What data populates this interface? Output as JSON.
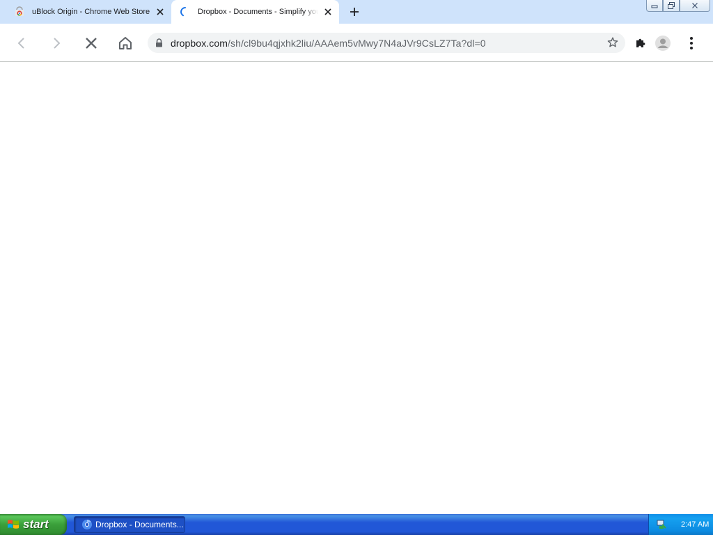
{
  "browser": {
    "tabs": [
      {
        "title": "uBlock Origin - Chrome Web Store",
        "favicon": "chrome-web-store-icon",
        "active": false
      },
      {
        "title": "Dropbox - Documents - Simplify your",
        "favicon": "loading-spinner-icon",
        "active": true
      }
    ],
    "address_bar": {
      "url_host": "dropbox.com",
      "url_path": "/sh/cl9bu4qjxhk2liu/AAAem5vMwy7N4aJVr9CsLZ7Ta?dl=0"
    }
  },
  "taskbar": {
    "start_label": "start",
    "task_items": [
      {
        "label": "Dropbox - Documents...",
        "icon": "chrome-icon"
      }
    ],
    "clock": "2:47 AM"
  },
  "colors": {
    "tab_strip": "#cfe3fb",
    "taskbar_blue": "#2157d7",
    "start_green": "#3a9f3a"
  }
}
